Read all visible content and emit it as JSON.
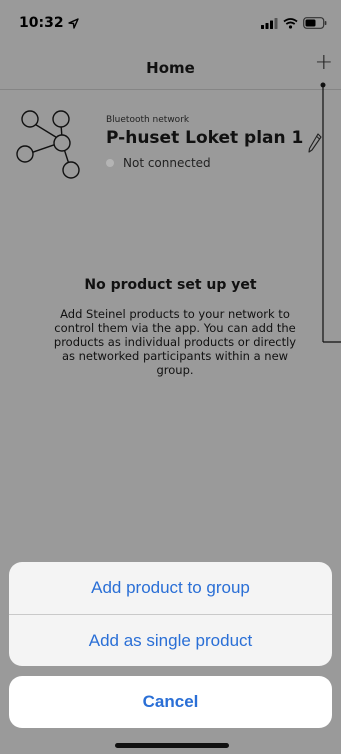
{
  "status_bar": {
    "time": "10:32",
    "icons": [
      "location-arrow-icon",
      "signal-icon",
      "wifi-icon",
      "battery-icon"
    ]
  },
  "nav": {
    "title": "Home",
    "add_icon": "plus-icon",
    "add_label": "+"
  },
  "network": {
    "kind_label": "Bluetooth network",
    "name": "P-huset Loket plan 1",
    "status": "Not connected",
    "icon": "network-graph-icon",
    "edit_icon": "pencil-icon"
  },
  "empty_state": {
    "title": "No product set up yet",
    "description": "Add Steinel products to your network to control them via the app. You can add the products as individual products or directly as networked participants within a new group."
  },
  "action_sheet": {
    "options": [
      {
        "label": "Add product to group"
      },
      {
        "label": "Add as single product"
      }
    ],
    "cancel_label": "Cancel"
  },
  "colors": {
    "background": "#9a9a9a",
    "sheet_background": "#f4f4f4",
    "action_blue": "#2a6fd6",
    "status_dot": "#b4b4b4"
  }
}
